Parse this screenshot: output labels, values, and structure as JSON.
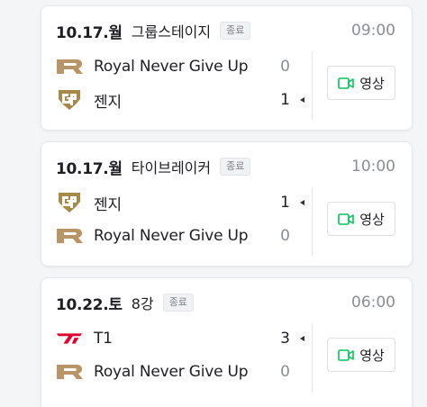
{
  "matches": [
    {
      "date": "10.17.월",
      "stage": "그룹스테이지",
      "status": "종료",
      "time": "09:00",
      "teams": [
        {
          "name": "Royal Never Give Up",
          "score": "0",
          "logo": "rng-logo",
          "winner": false
        },
        {
          "name": "젠지",
          "score": "1",
          "logo": "geng-logo",
          "winner": true
        }
      ],
      "video_label": "영상"
    },
    {
      "date": "10.17.월",
      "stage": "타이브레이커",
      "status": "종료",
      "time": "10:00",
      "teams": [
        {
          "name": "젠지",
          "score": "1",
          "logo": "geng-logo",
          "winner": true
        },
        {
          "name": "Royal Never Give Up",
          "score": "0",
          "logo": "rng-logo",
          "winner": false
        }
      ],
      "video_label": "영상"
    },
    {
      "date": "10.22.토",
      "stage": "8강",
      "status": "종료",
      "time": "06:00",
      "teams": [
        {
          "name": "T1",
          "score": "3",
          "logo": "t1-logo",
          "winner": true
        },
        {
          "name": "Royal Never Give Up",
          "score": "0",
          "logo": "rng-logo",
          "winner": false
        }
      ],
      "video_label": "영상"
    }
  ],
  "colors": {
    "rng": "#b89466",
    "geng": "#a8894a",
    "t1": "#e2012d",
    "video_icon": "#03c75a"
  }
}
